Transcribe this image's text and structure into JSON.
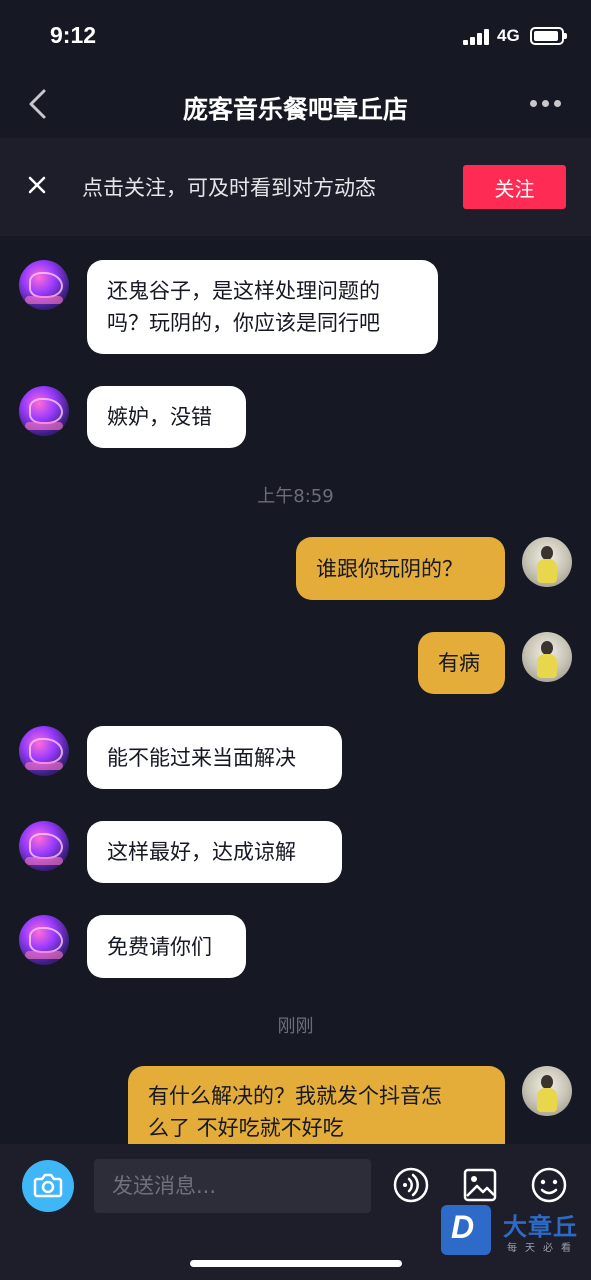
{
  "status_bar": {
    "time": "9:12",
    "network": "4G"
  },
  "nav": {
    "title": "庞客音乐餐吧章丘店"
  },
  "follow_bar": {
    "text": "点击关注，可及时看到对方动态",
    "button": "关注"
  },
  "messages": [
    {
      "side": "in",
      "text_lines": [
        "还鬼谷子，是这样处理问题的",
        "吗？玩阴的，你应该是同行吧"
      ]
    },
    {
      "side": "in",
      "text_lines": [
        "嫉妒，没错"
      ]
    },
    {
      "type": "time",
      "text": "上午8:59"
    },
    {
      "side": "out",
      "text_lines": [
        "谁跟你玩阴的？"
      ]
    },
    {
      "side": "out",
      "text_lines": [
        "有病"
      ]
    },
    {
      "side": "in",
      "text_lines": [
        "能不能过来当面解决"
      ]
    },
    {
      "side": "in",
      "text_lines": [
        "这样最好，达成谅解"
      ]
    },
    {
      "side": "in",
      "text_lines": [
        "免费请你们"
      ]
    },
    {
      "type": "time",
      "text": "刚刚"
    },
    {
      "side": "out",
      "text_lines": [
        "有什么解决的？我就发个抖音怎",
        "么了 不好吃就不好吃"
      ]
    }
  ],
  "input": {
    "placeholder": "发送消息..."
  },
  "icons": {
    "camera": "camera-icon",
    "voice": "voice-icon",
    "image": "image-icon",
    "emoji": "emoji-icon"
  },
  "watermark": {
    "logo_letter": "D",
    "title": "大章丘",
    "subtitle": "每天必看"
  },
  "colors": {
    "background": "#161823",
    "incoming_bubble": "#ffffff",
    "outgoing_bubble": "#e4ad3a",
    "follow_button": "#fe2c55",
    "camera_button": "#3fb6f5"
  }
}
